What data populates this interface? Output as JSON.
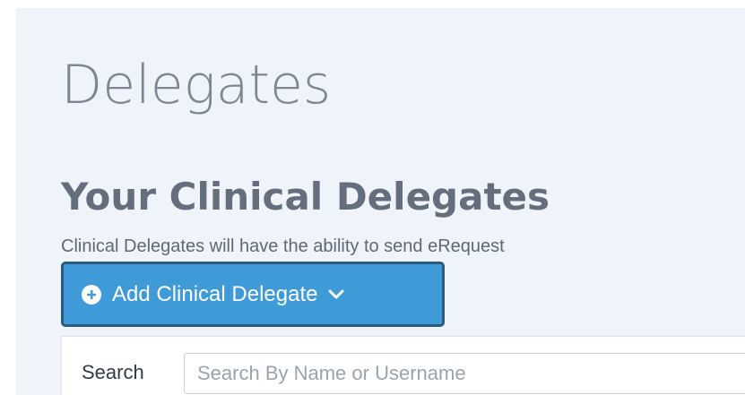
{
  "page": {
    "title": "Delegates"
  },
  "section": {
    "title": "Your Clinical Delegates",
    "description": "Clinical Delegates will have the ability to send eRequest"
  },
  "add_button": {
    "label": "Add Clinical Delegate",
    "icon": "plus-circle-icon",
    "dropdown_icon": "chevron-down-icon"
  },
  "search": {
    "label": "Search",
    "placeholder": "Search By Name or Username",
    "value": ""
  },
  "colors": {
    "page_background": "#eef4f9",
    "button_background": "#3f9bd8",
    "button_border": "#2c5a7f",
    "title_text": "#7d8794"
  }
}
